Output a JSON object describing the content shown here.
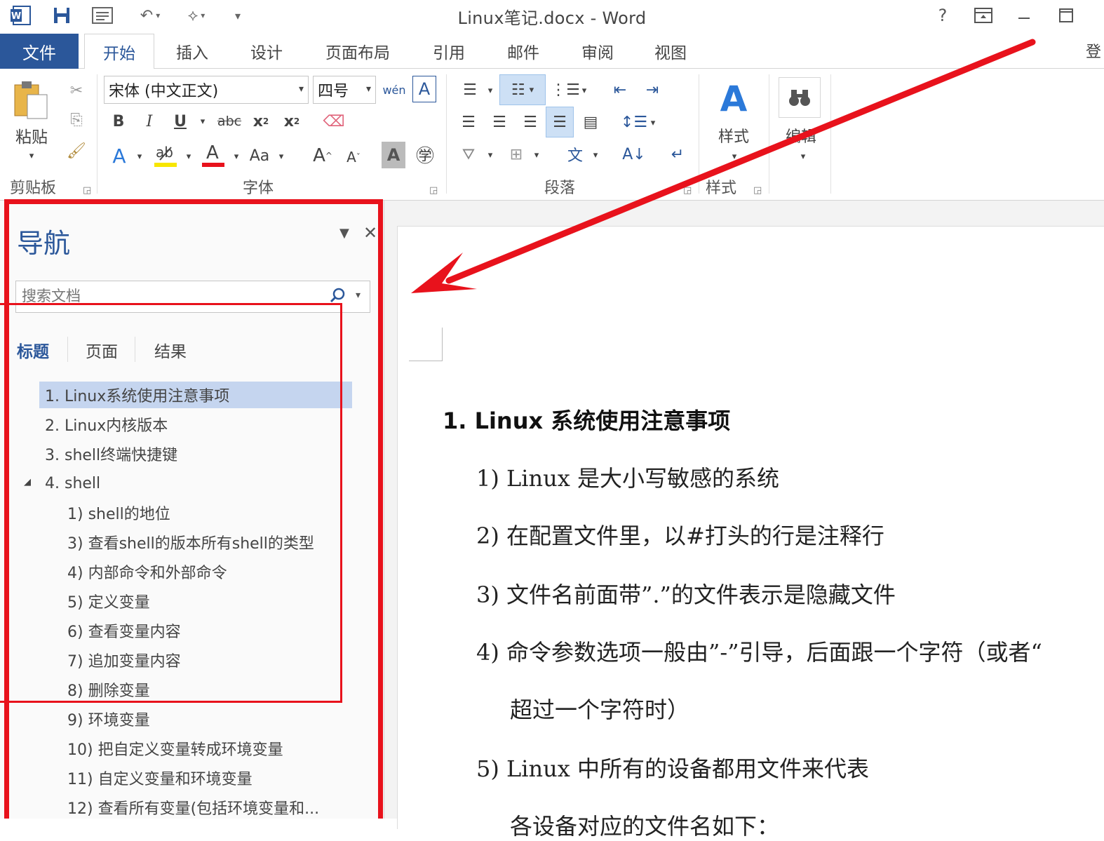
{
  "app": {
    "document_title": "Linux笔记.docx - Word",
    "word_icon": "word-app-icon",
    "qat_icons": [
      "save-icon",
      "read-mode-icon",
      "undo-icon",
      "touch-mouse-mode-icon",
      "customize-qat-icon"
    ],
    "window_controls": {
      "help": "?",
      "ribbon_display": "ribbon-display-options-icon",
      "minimize": "minimize-icon",
      "maximize": "maximize-icon"
    },
    "signin_stub": "登"
  },
  "ribbon": {
    "file_tab": "文件",
    "tabs": [
      "开始",
      "插入",
      "设计",
      "页面布局",
      "引用",
      "邮件",
      "审阅",
      "视图"
    ],
    "active_tab": "开始",
    "clipboard": {
      "paste": "粘贴",
      "label": "剪贴板"
    },
    "font": {
      "font_name": "宋体 (中文正文)",
      "font_size": "四号",
      "label": "字体",
      "change_case": "Aa"
    },
    "paragraph": {
      "label": "段落"
    },
    "styles": {
      "button": "样式",
      "label": "样式"
    },
    "editing": {
      "button": "编辑"
    }
  },
  "nav": {
    "title": "导航",
    "search_placeholder": "搜索文档",
    "tabs": [
      "标题",
      "页面",
      "结果"
    ],
    "items": [
      "1. Linux系统使用注意事项",
      "2. Linux内核版本",
      "3. shell终端快捷键",
      "4. shell",
      "1) shell的地位",
      "3) 查看shell的版本所有shell的类型",
      "4) 内部命令和外部命令",
      "5) 定义变量",
      "6) 查看变量内容",
      "7) 追加变量内容",
      "8) 删除变量",
      "9) 环境变量",
      "10) 把自定义变量转成环境变量",
      "11) 自定义变量和环境变量",
      "12) 查看所有变量(包括环境变量和..."
    ]
  },
  "document": {
    "heading": "1.  Linux 系统使用注意事项",
    "lines": [
      "1)  Linux 是大小写敏感的系统",
      "2)  在配置文件里，以#打头的行是注释行",
      "3)  文件名前面带”.”的文件表示是隐藏文件",
      "4)  命令参数选项一般由”-”引导，后面跟一个字符（或者“",
      "超过一个字符时）",
      "5)  Linux 中所有的设备都用文件来代表",
      "各设备对应的文件名如下："
    ]
  },
  "annotation_color": "#e8121c"
}
